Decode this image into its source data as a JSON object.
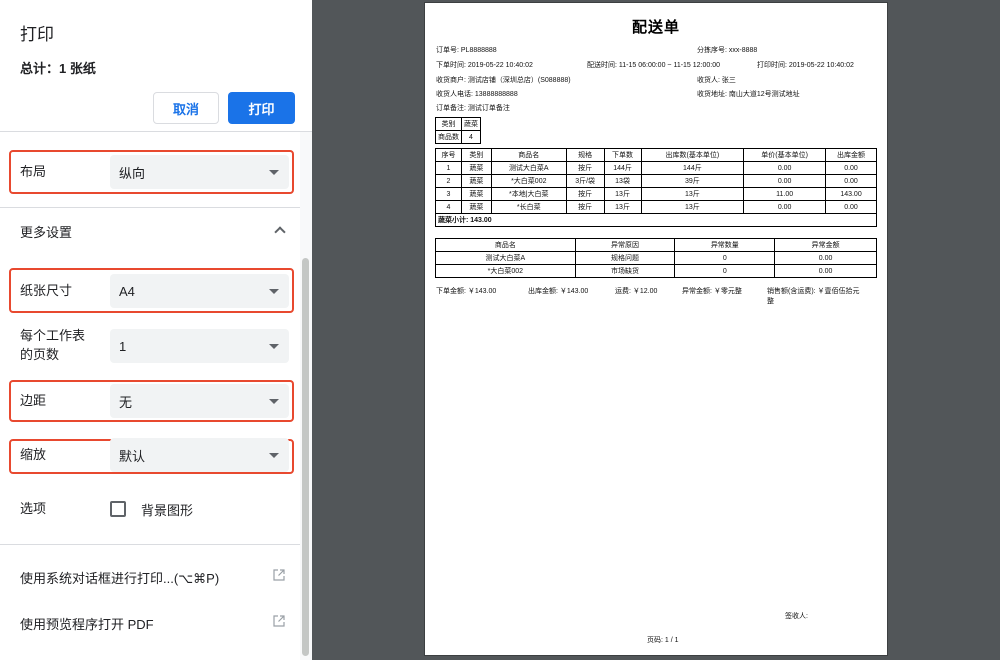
{
  "dialog": {
    "title": "打印",
    "total": "总计：1 张纸",
    "cancel_label": "取消",
    "print_label": "打印"
  },
  "settings": {
    "layout": {
      "label": "布局",
      "value": "纵向"
    },
    "more_settings": "更多设置",
    "paper_size": {
      "label": "纸张尺寸",
      "value": "A4"
    },
    "pages_per_sheet": {
      "label_line1": "每个工作表",
      "label_line2": "的页数",
      "value": "1"
    },
    "margins": {
      "label": "边距",
      "value": "无"
    },
    "scale": {
      "label": "缩放",
      "value": "默认"
    },
    "options": {
      "label": "选项",
      "background_graphics": "背景图形",
      "background_graphics_checked": false
    },
    "system_dialog": "使用系统对话框进行打印...(⌥⌘P)",
    "open_pdf": "使用预览程序打开 PDF"
  },
  "highlight_color": "#e8492f",
  "accent_color": "#1a73e8",
  "doc": {
    "title": "配送单",
    "order_no": "订单号: PL8888888",
    "sort_no": "分拣序号:  xxx-8888",
    "order_time": "下单时间:  2019-05-22 10:40:02",
    "delivery_time": "配送时间:  11-15 06:00:00 ~ 11-15 12:00:00",
    "print_time": "打印时间:  2019-05-22 10:40:02",
    "merchant": "收货商户: 测试店铺（深圳总店）(S088888)",
    "receiver": "收货人: 张三",
    "phone": "收货人电话: 13888888888",
    "address": "收货地址: 南山大道12号测试地址",
    "remark": "订单备注: 测试订单备注",
    "category_table": [
      [
        "类别",
        "蔬菜"
      ],
      [
        "商品数",
        "4"
      ]
    ],
    "items_header": [
      "序号",
      "类别",
      "商品名",
      "规格",
      "下单数",
      "出库数(基本单位)",
      "单价(基本单位)",
      "出库金额"
    ],
    "items": [
      [
        "1",
        "蔬菜",
        "测试大白菜A",
        "按斤",
        "144斤",
        "144斤",
        "0.00",
        "0.00"
      ],
      [
        "2",
        "蔬菜",
        "*大白菜002",
        "3斤/袋",
        "13袋",
        "39斤",
        "0.00",
        "0.00"
      ],
      [
        "3",
        "蔬菜",
        "*本地|大白菜",
        "按斤",
        "13斤",
        "13斤",
        "11.00",
        "143.00"
      ],
      [
        "4",
        "蔬菜",
        "*长白菜",
        "按斤",
        "13斤",
        "13斤",
        "0.00",
        "0.00"
      ]
    ],
    "subtotal": "蔬菜小计:  143.00",
    "exception_header": [
      "商品名",
      "异常原因",
      "异常数量",
      "异常金额"
    ],
    "exceptions": [
      [
        "测试大白菜A",
        "规格问题",
        "0",
        "0.00"
      ],
      [
        "*大白菜002",
        "市场缺货",
        "0",
        "0.00"
      ]
    ],
    "order_amount": "下单金额:  ￥143.00",
    "out_amount": "出库金额:  ￥143.00",
    "freight": "运费:  ￥12.00",
    "exception_amount": "异常金额:  ￥零元整",
    "sales_line1": "销售额(含运费):  ￥壹佰伍拾元",
    "sales_line2": "整",
    "signer": "签收人:",
    "page_no": "页码:   1 / 1"
  }
}
